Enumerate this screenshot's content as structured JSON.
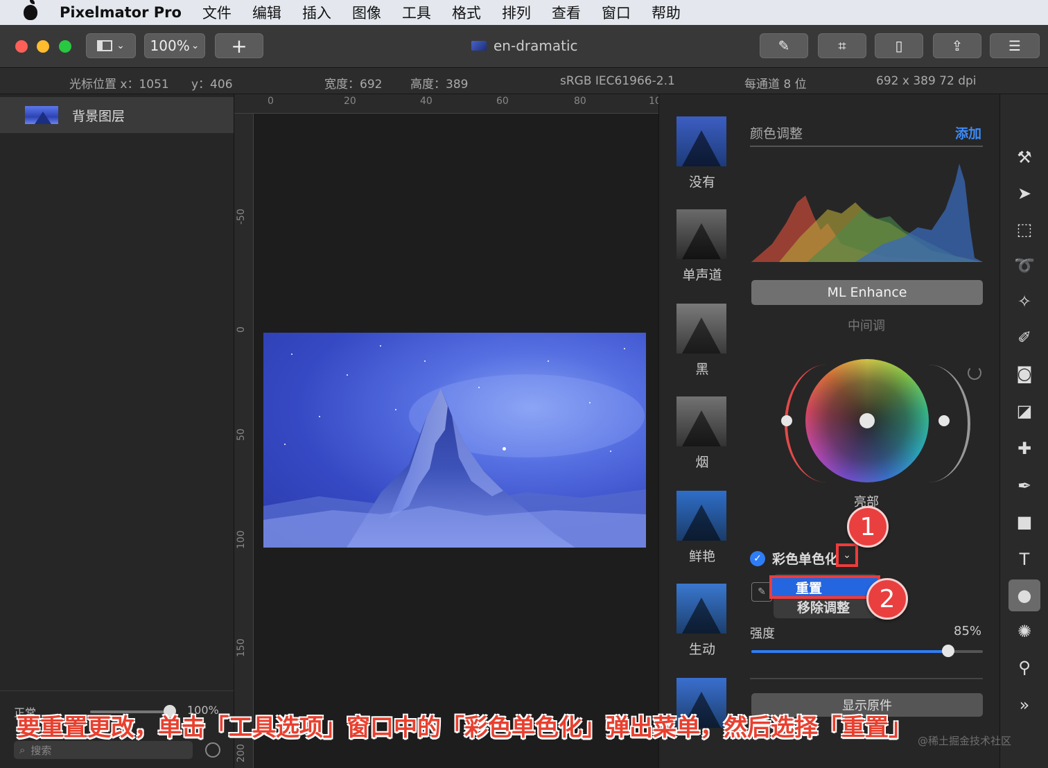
{
  "menubar": {
    "app_name": "Pixelmator Pro",
    "items": [
      "文件",
      "编辑",
      "插入",
      "图像",
      "工具",
      "格式",
      "排列",
      "查看",
      "窗口",
      "帮助"
    ]
  },
  "toolbar": {
    "zoom": "100%",
    "add_label": "+",
    "document_title": "en-dramatic",
    "icons": [
      "sidebar-toggle-icon",
      "ml-brush-icon",
      "crop-icon",
      "document-icon",
      "share-icon",
      "tool-options-icon"
    ]
  },
  "info": {
    "cursor_x": "光标位置 x：1051",
    "cursor_y": "y：406",
    "width": "宽度：692",
    "height": "高度：389",
    "color_profile": "sRGB IEC61966-2.1",
    "bit_depth": "每通道 8 位",
    "size_dpi": "692 x 389 72 dpi"
  },
  "layers": {
    "items": [
      {
        "name": "背景图层"
      }
    ],
    "blend_mode": "正常",
    "opacity": "100%",
    "search_placeholder": "搜索"
  },
  "rulers": {
    "h_ticks": [
      "0",
      "20",
      "40",
      "60",
      "80",
      "10"
    ],
    "v_ticks": [
      "-50",
      "0",
      "50",
      "100",
      "150",
      "200"
    ]
  },
  "presets": [
    {
      "label": "没有",
      "tone": "color"
    },
    {
      "label": "单声道",
      "tone": "mono"
    },
    {
      "label": "黑",
      "tone": "mono"
    },
    {
      "label": "烟",
      "tone": "mono"
    },
    {
      "label": "鲜艳",
      "tone": "color"
    },
    {
      "label": "生动",
      "tone": "color"
    }
  ],
  "adjustments": {
    "title": "颜色调整",
    "add_label": "添加",
    "ml_enhance": "ML Enhance",
    "midtones_label": "中间调",
    "highlights_label": "亮部",
    "monochrome_label": "彩色单色化",
    "monochrome_enabled": true,
    "menu_items": [
      "重置",
      "移除调整"
    ],
    "strength_label": "强度",
    "strength_value": "85%",
    "strength_fraction": 0.85,
    "show_original": "显示原件"
  },
  "badges": [
    "1",
    "2"
  ],
  "caption": "要重置更改，单击「工具选项」窗口中的「彩色单色化」弹出菜单，然后选择「重置」",
  "watermark": "@稀土掘金技术社区",
  "tools": [
    "paint-brush-icon",
    "arrow-pointer-icon",
    "rect-select-icon",
    "lasso-icon",
    "magic-wand-icon",
    "brush-icon",
    "bucket-icon",
    "eraser-icon",
    "bandage-icon",
    "pen-icon",
    "shape-icon",
    "text-icon",
    "color-adjust-icon",
    "distort-icon",
    "zoom-icon",
    "more-icon"
  ],
  "colors": {
    "accent": "#2f7df6",
    "highlight_red": "#ee3b3b",
    "menubar_bg": "#e4e8ee"
  }
}
